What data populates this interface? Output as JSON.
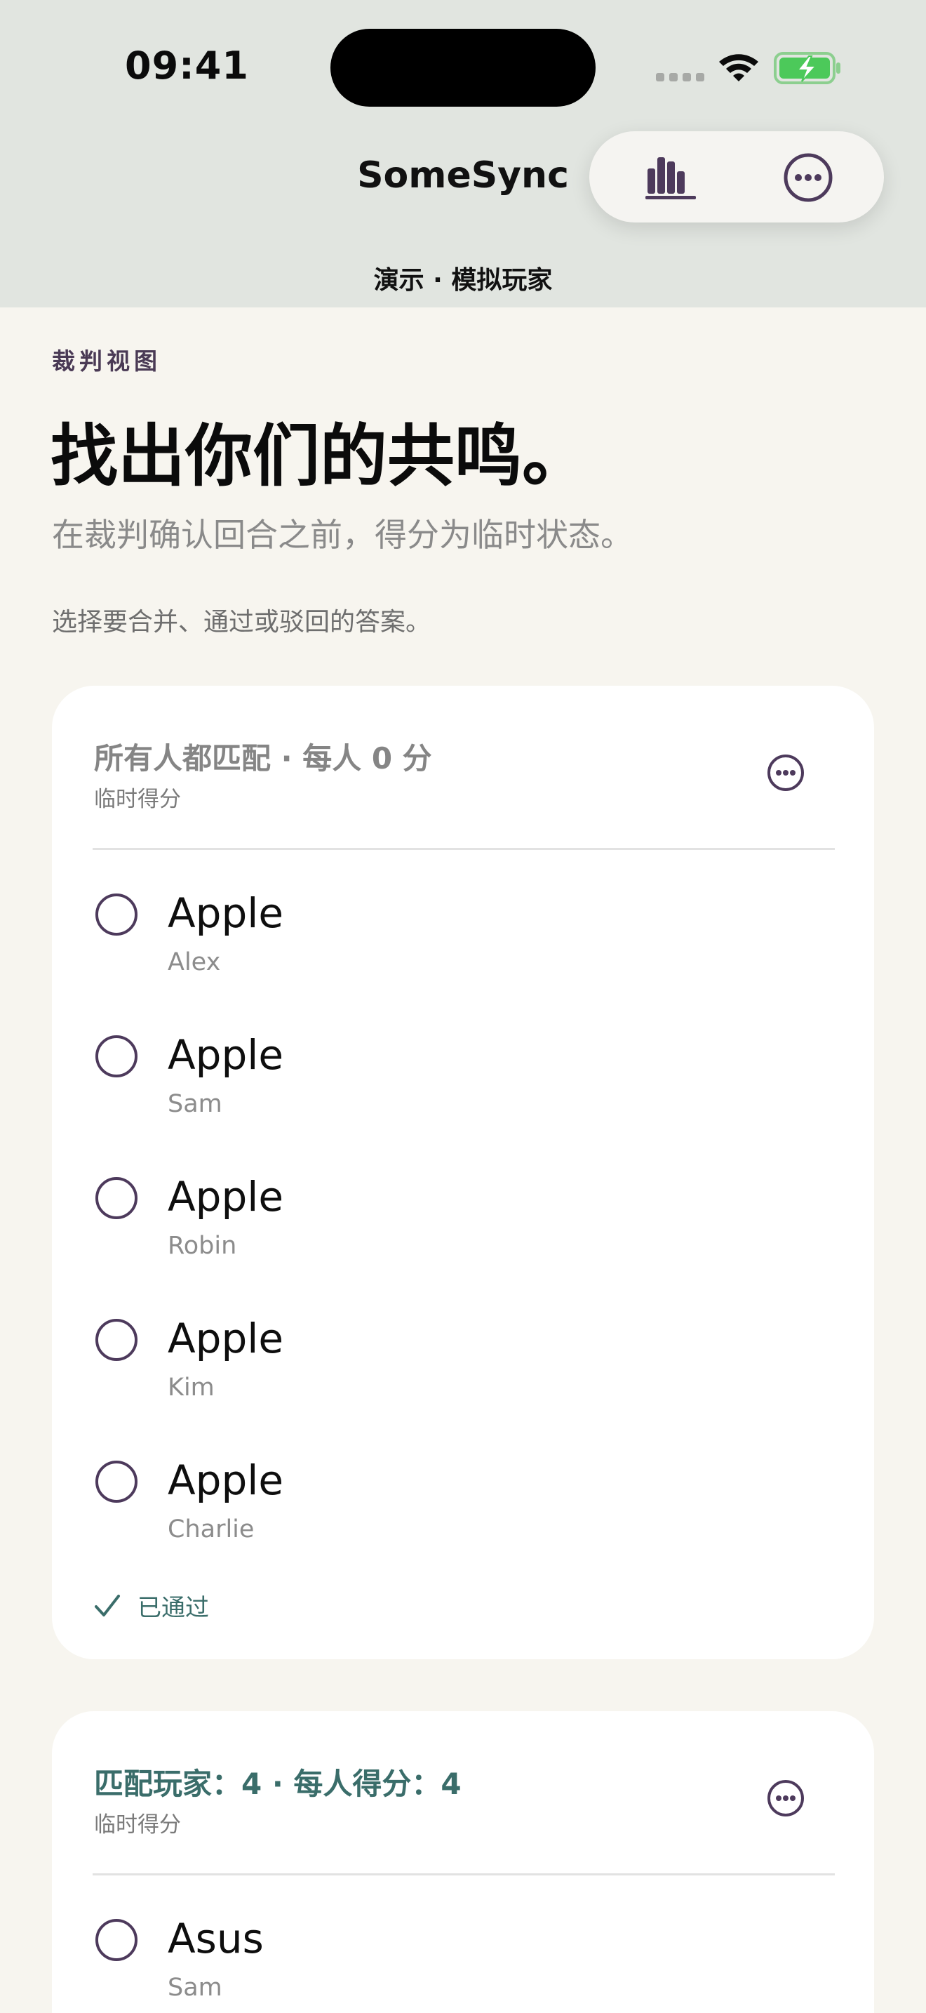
{
  "status_bar": {
    "time": "09:41"
  },
  "header": {
    "app_title": "SomeSync",
    "subtitle": "演示 · 模拟玩家"
  },
  "toolbar": {
    "stats_icon": "bar-chart-icon",
    "more_icon": "ellipsis-circle-icon"
  },
  "intro": {
    "eyebrow": "裁判视图",
    "headline": "找出你们的共鸣。",
    "lead": "在裁判确认回合之前，得分为临时状态。",
    "hint": "选择要合并、通过或驳回的答案。"
  },
  "groups": [
    {
      "title": "所有人都匹配 · 每人 0 分",
      "subtitle": "临时得分",
      "title_color": "#858585",
      "answers": [
        {
          "answer": "Apple",
          "player": "Alex"
        },
        {
          "answer": "Apple",
          "player": "Sam"
        },
        {
          "answer": "Apple",
          "player": "Robin"
        },
        {
          "answer": "Apple",
          "player": "Kim"
        },
        {
          "answer": "Apple",
          "player": "Charlie"
        }
      ],
      "status": "已通过"
    },
    {
      "title": "匹配玩家：4 · 每人得分：4",
      "subtitle": "临时得分",
      "title_color": "#3a6d6a",
      "answers": [
        {
          "answer": "Asus",
          "player": "Sam"
        }
      ]
    }
  ],
  "colors": {
    "header_bg": "#e1e5e0",
    "page_bg": "#f7f5ef",
    "accent_purple": "#4d3a5c",
    "accent_teal": "#3a6d6a",
    "battery_green": "#4cc95a"
  }
}
